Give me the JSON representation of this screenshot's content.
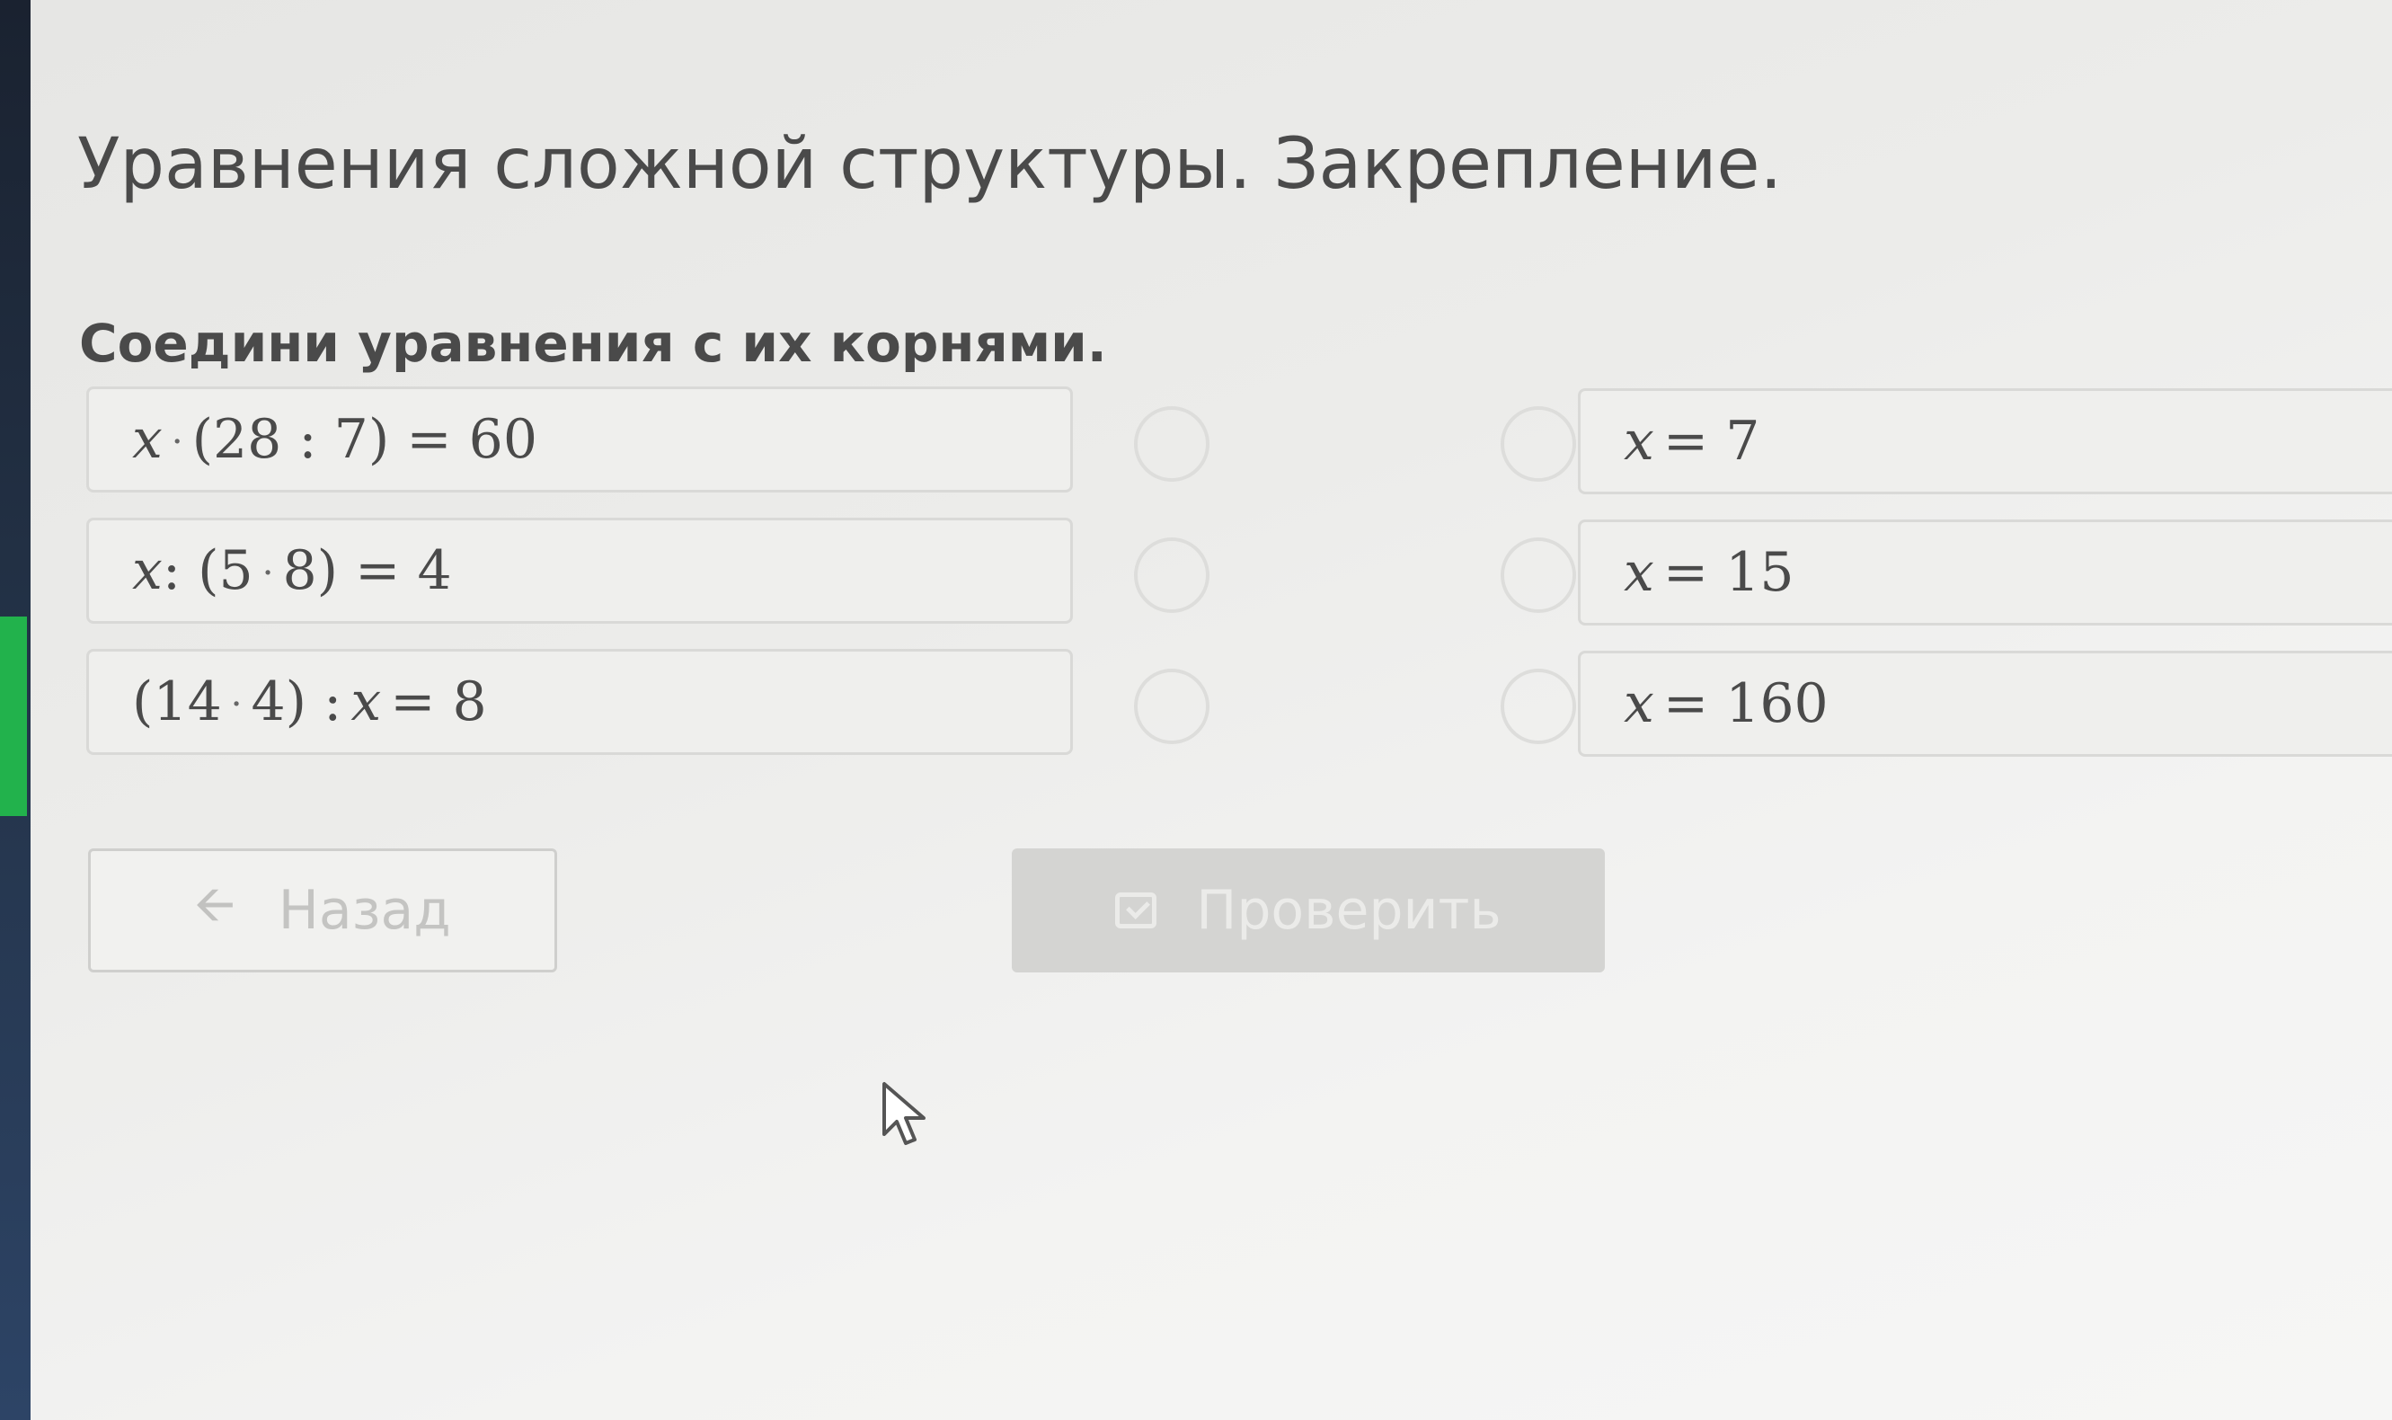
{
  "page": {
    "title": "Уравнения сложной структуры. Закрепление.",
    "task": "Соедини уравнения с их корнями."
  },
  "equations": [
    {
      "parts": [
        "x",
        "·",
        "(28 : 7) = 60"
      ]
    },
    {
      "parts": [
        "x",
        ": (5",
        "·",
        "8) = 4"
      ]
    },
    {
      "parts": [
        "(14",
        "·",
        "4) :",
        "x",
        "= 8"
      ]
    }
  ],
  "roots": [
    {
      "var": "x",
      "rest": "= 7"
    },
    {
      "var": "x",
      "rest": "= 15"
    },
    {
      "var": "x",
      "rest": "= 160"
    }
  ],
  "buttons": {
    "back_label": "Назад",
    "back_icon": "arrow-left-icon",
    "check_label": "Проверить",
    "check_icon": "check-square-icon"
  },
  "colors": {
    "accent_green": "#22b24c",
    "sidebar_dark": "#233247",
    "text": "#4a4a4a",
    "button_disabled": "#d4d4d2"
  }
}
